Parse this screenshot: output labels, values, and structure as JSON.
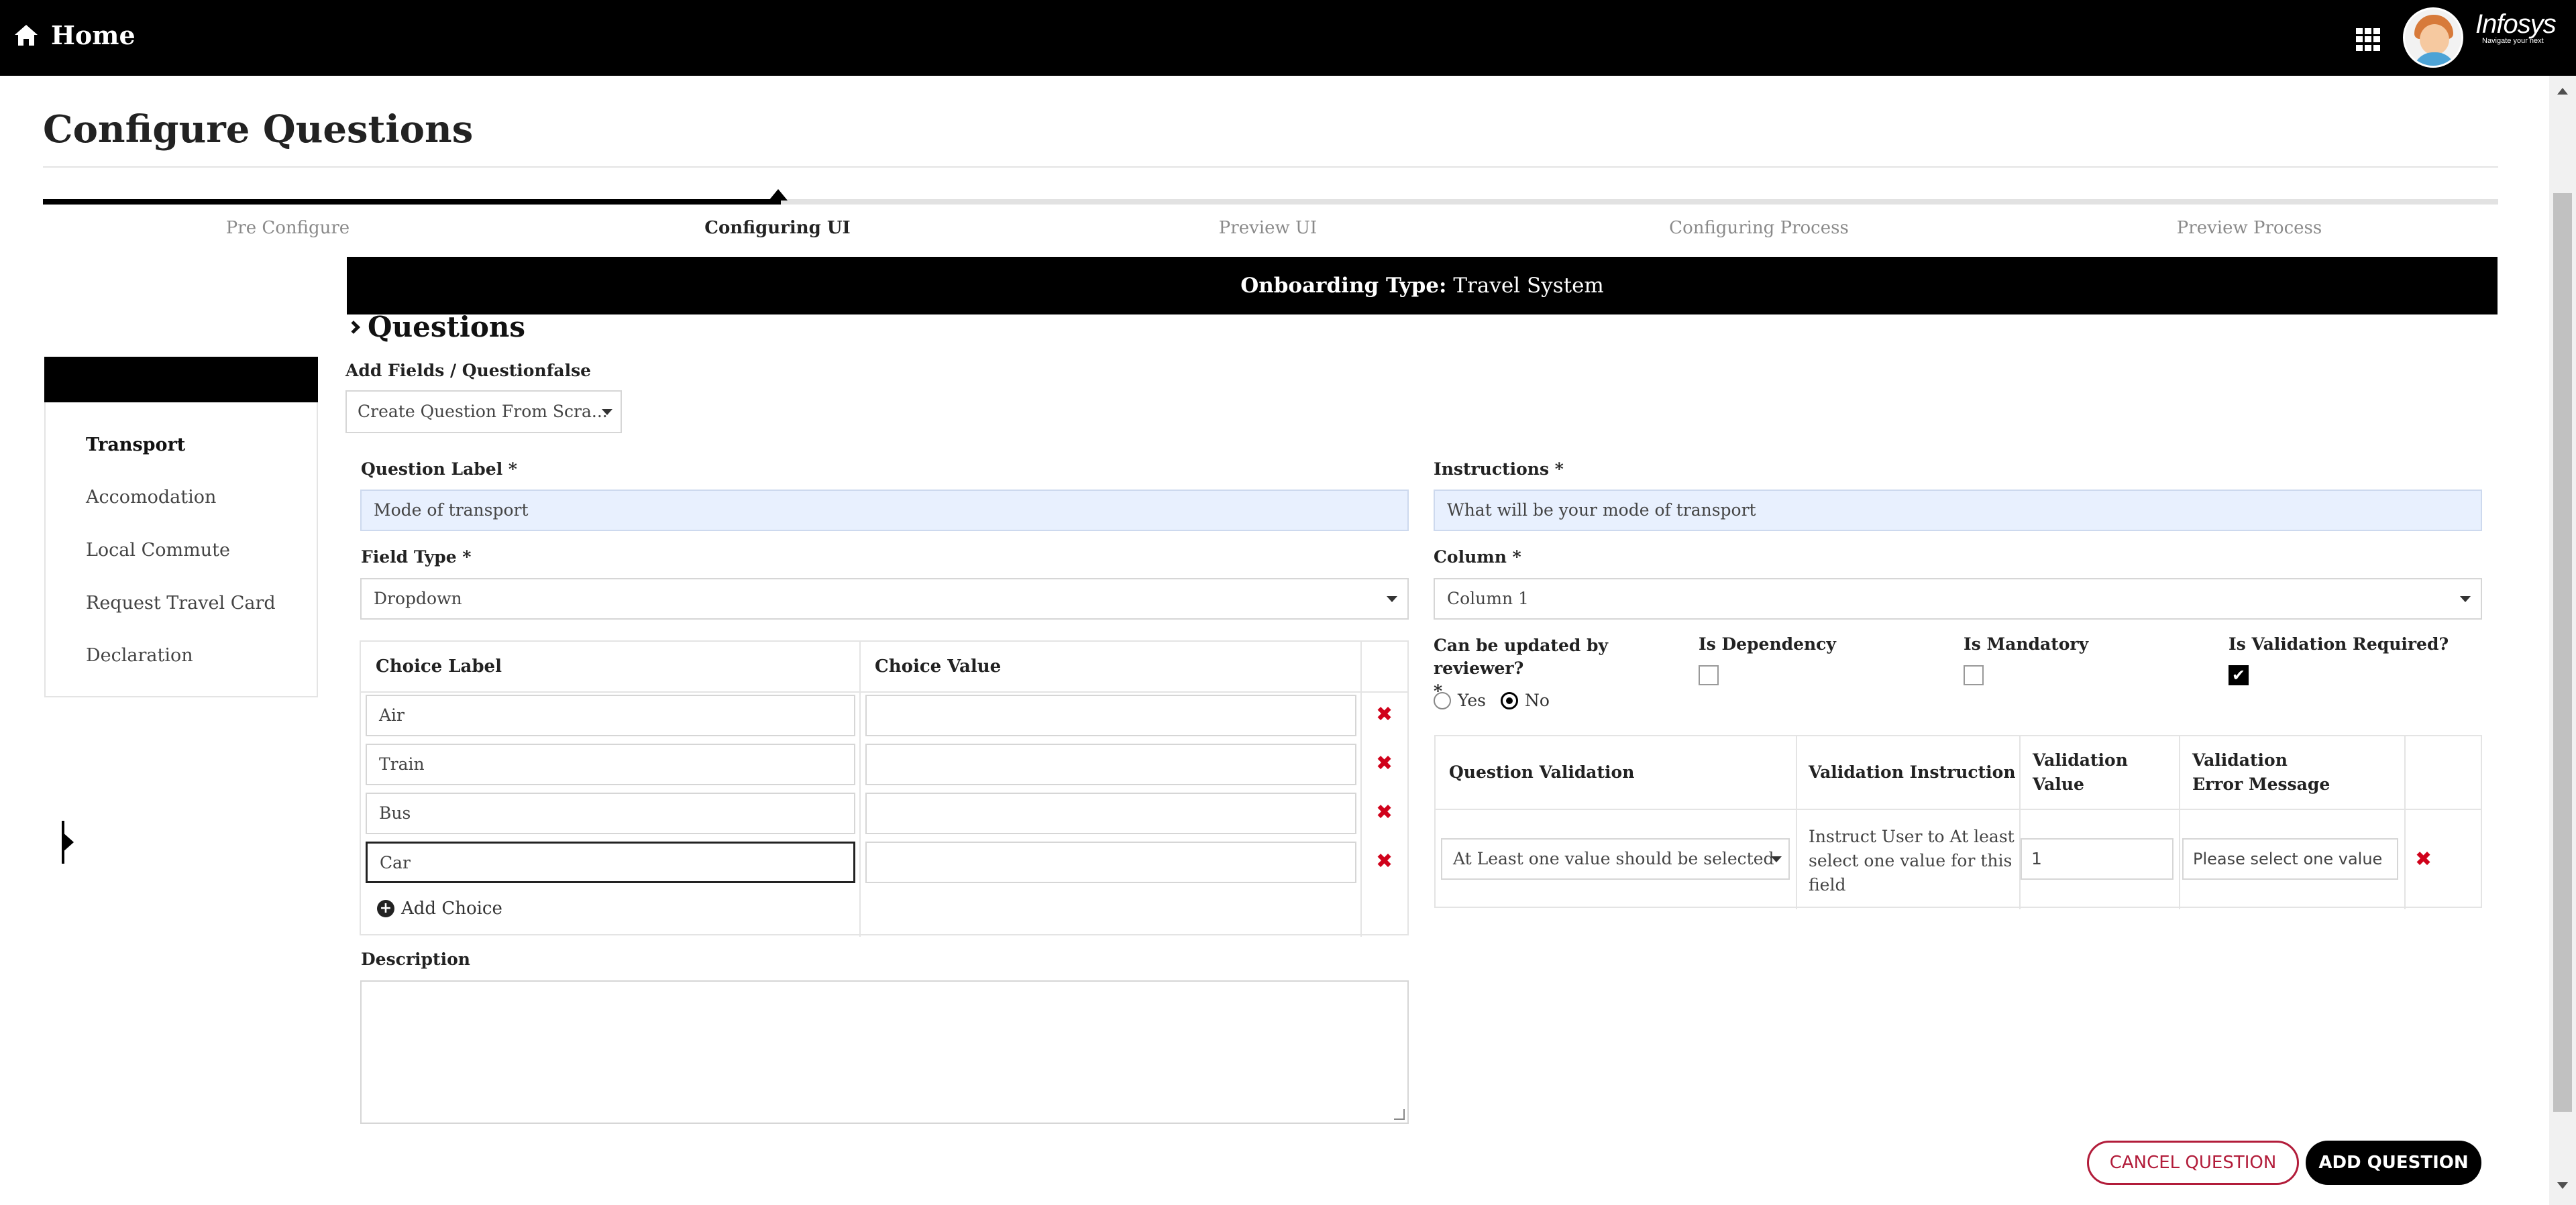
{
  "topbar": {
    "home_label": "Home",
    "brand_name": "Infosys",
    "brand_tagline": "Navigate your next"
  },
  "page": {
    "title": "Configure Questions"
  },
  "stepper": {
    "steps": [
      "Pre Configure",
      "Configuring UI",
      "Preview UI",
      "Configuring Process",
      "Preview Process"
    ],
    "active_index": 1
  },
  "banner": {
    "prefix": "Onboarding Type:",
    "value": "Travel System"
  },
  "section": {
    "title": "Questions"
  },
  "sidenav": {
    "items": [
      "Transport",
      "Accomodation",
      "Local Commute",
      "Request Travel Card",
      "Declaration"
    ],
    "active_index": 0
  },
  "form": {
    "add_fields_label": "Add Fields / Questionfalse",
    "add_fields_value": "Create Question From Scra...",
    "question_label_label": "Question Label",
    "question_label_value": "Mode of transport",
    "instructions_label": "Instructions",
    "instructions_value": "What will be your mode of transport",
    "field_type_label": "Field Type",
    "field_type_value": "Dropdown",
    "column_label": "Column",
    "column_value": "Column 1",
    "required_mark": "*",
    "description_label": "Description",
    "description_value": ""
  },
  "choices": {
    "header_label": "Choice Label",
    "header_value": "Choice Value",
    "rows": [
      {
        "label": "Air",
        "value": ""
      },
      {
        "label": "Train",
        "value": ""
      },
      {
        "label": "Bus",
        "value": ""
      },
      {
        "label": "Car",
        "value": ""
      }
    ],
    "add_label": "Add Choice"
  },
  "options": {
    "updated_by_reviewer": "Can be updated by reviewer?",
    "yes_label": "Yes",
    "no_label": "No",
    "selected": "No",
    "is_dependency": "Is Dependency",
    "is_dependency_checked": false,
    "is_mandatory": "Is Mandatory",
    "is_mandatory_checked": false,
    "is_validation_required": "Is Validation Required?",
    "is_validation_required_checked": true
  },
  "validation": {
    "headers": [
      "Question Validation",
      "Validation Instruction",
      "Validation Value",
      "Validation Error Message"
    ],
    "row": {
      "question_validation": "At Least one value should be selected",
      "instruction": "Instruct User to At least select one value  for this field",
      "value": "1",
      "error_message": "Please select one value"
    }
  },
  "buttons": {
    "cancel": "CANCEL QUESTION",
    "add": "ADD QUESTION"
  },
  "colors": {
    "brand_black": "#000000",
    "delete_red": "#d0021b",
    "cancel_red": "#b21c3a",
    "input_blue": "#e8f0fe"
  }
}
